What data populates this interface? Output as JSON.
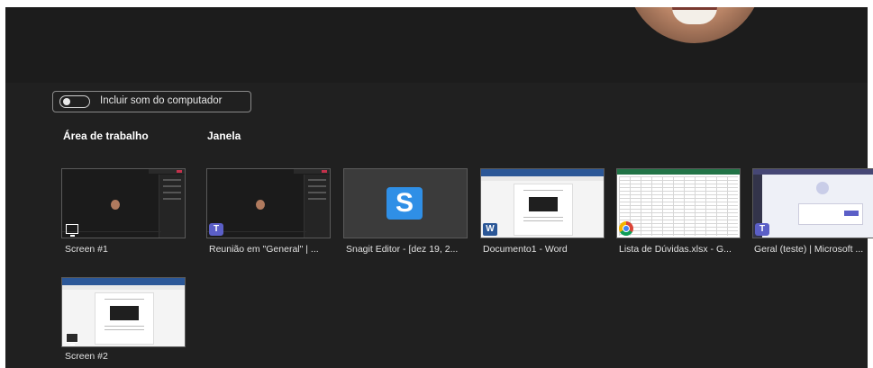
{
  "toggle": {
    "label": "Incluir som do computador",
    "on": false
  },
  "sections": {
    "desktop": "Área de trabalho",
    "window": "Janela"
  },
  "thumbnails": [
    {
      "label": "Screen #1",
      "icon": "monitor-icon"
    },
    {
      "label": "Reunião em \"General\" | ...",
      "icon": "teams-icon"
    },
    {
      "label": "Snagit Editor - [dez 19, 2...",
      "icon": "snagit-icon"
    },
    {
      "label": "Documento1 - Word",
      "icon": "word-icon"
    },
    {
      "label": "Lista de Dúvidas.xlsx - G...",
      "icon": "chrome-icon"
    },
    {
      "label": "Geral (teste) | Microsoft ...",
      "icon": "teams-icon"
    },
    {
      "label": "Screen #2",
      "icon": "monitor-icon"
    }
  ],
  "icons": {
    "snagit_glyph": "S",
    "teams_glyph": "T",
    "word_glyph": "W"
  },
  "colors": {
    "background": "#202020",
    "teams": "#5b5fc7",
    "word": "#2b5797",
    "snagit": "#2f8fe6",
    "excel": "#217346"
  }
}
